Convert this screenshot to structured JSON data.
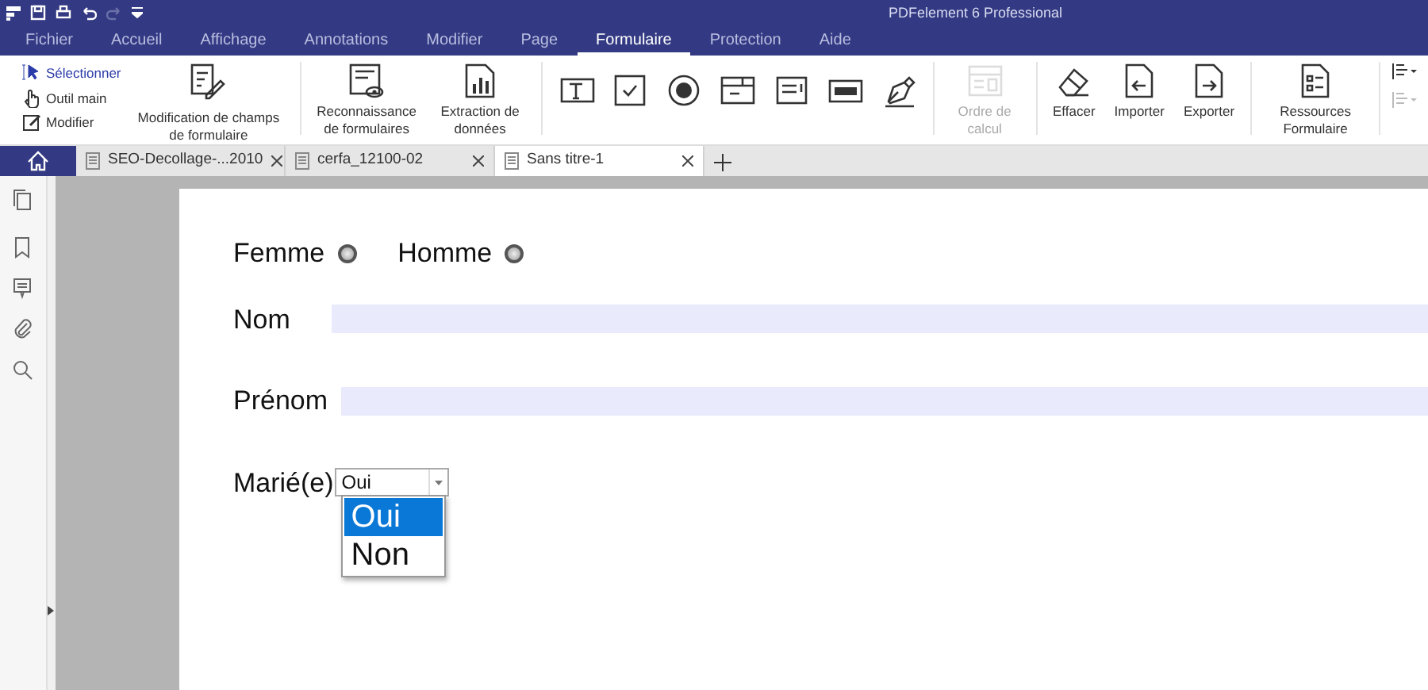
{
  "window": {
    "title": "PDFelement 6 Professional"
  },
  "menu": [
    {
      "label": "Fichier",
      "selected": false
    },
    {
      "label": "Accueil",
      "selected": false
    },
    {
      "label": "Affichage",
      "selected": false
    },
    {
      "label": "Annotations",
      "selected": false
    },
    {
      "label": "Modifier",
      "selected": false
    },
    {
      "label": "Page",
      "selected": false
    },
    {
      "label": "Formulaire",
      "selected": true
    },
    {
      "label": "Protection",
      "selected": false
    },
    {
      "label": "Aide",
      "selected": false
    }
  ],
  "ribbon": {
    "groups": [
      [
        {
          "kind": "stack",
          "tools": [
            {
              "label": "Sélectionner",
              "selected": true
            },
            {
              "label": "Outil main",
              "selected": false
            },
            {
              "label": "Modifier",
              "selected": false
            }
          ]
        },
        {
          "kind": "large",
          "label": "Modification de champs de formulaire",
          "disabled": false
        }
      ],
      [
        {
          "kind": "large",
          "label": "Reconnaissance de formulaires",
          "disabled": false
        },
        {
          "kind": "large",
          "label": "Extraction de données",
          "disabled": false
        }
      ],
      [
        {
          "kind": "icon",
          "disabled": false
        },
        {
          "kind": "icon",
          "disabled": false
        },
        {
          "kind": "icon",
          "disabled": false
        },
        {
          "kind": "icon",
          "disabled": false
        },
        {
          "kind": "icon",
          "disabled": false
        },
        {
          "kind": "icon",
          "disabled": false
        },
        {
          "kind": "icon",
          "disabled": false
        }
      ],
      [
        {
          "kind": "large",
          "label": "Ordre de calcul",
          "disabled": true
        }
      ],
      [
        {
          "kind": "large",
          "label": "Effacer",
          "disabled": false
        },
        {
          "kind": "large",
          "label": "Importer",
          "disabled": false
        },
        {
          "kind": "large",
          "label": "Exporter",
          "disabled": false
        }
      ],
      [
        {
          "kind": "large",
          "label": "Ressources Formulaire",
          "disabled": false
        }
      ],
      [
        {
          "kind": "dropdowns",
          "items": [
            {
              "disabled": false
            },
            {
              "disabled": true
            }
          ]
        }
      ]
    ]
  },
  "tabs": [
    {
      "label": "SEO-Decollage-...2010",
      "selected": false
    },
    {
      "label": "cerfa_12100-02",
      "selected": false
    },
    {
      "label": "Sans titre-1",
      "selected": true
    }
  ],
  "form": {
    "radios": [
      {
        "label": "Femme",
        "checked": false
      },
      {
        "label": "Homme",
        "checked": false
      }
    ],
    "fields": [
      {
        "label": "Nom"
      },
      {
        "label": "Prénom"
      }
    ],
    "combo": {
      "label": "Marié(e)",
      "value": "Oui",
      "expanded": true,
      "options": [
        {
          "label": "Oui",
          "selected": true
        },
        {
          "label": "Non",
          "selected": false
        }
      ]
    }
  }
}
